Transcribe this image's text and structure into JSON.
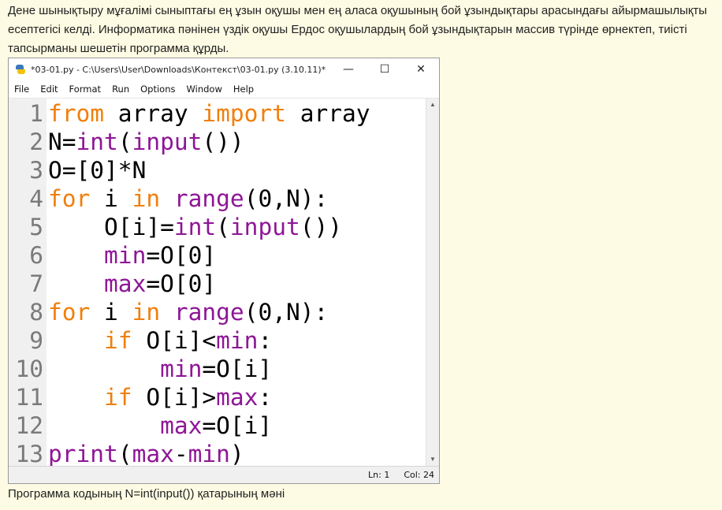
{
  "intro_text": "Дене шынықтыру мұғалімі сыныптағы ең ұзын оқушы мен ең аласа оқушының бой ұзындықтары арасындағы айырмашылықты есептегісі келді. Информатика пәнінен үздік оқушы Ердос оқушылардың бой ұзындықтарын массив түрінде өрнектеп, тиісті тапсырманы шешетін программа құрды.",
  "window": {
    "title": "*03-01.py - C:\\Users\\User\\Downloads\\Контекст\\03-01.py (3.10.11)*",
    "app_icon": "python-idle-icon",
    "controls": {
      "minimize": "—",
      "maximize": "☐",
      "close": "✕"
    }
  },
  "menu": [
    {
      "label": "File"
    },
    {
      "label": "Edit"
    },
    {
      "label": "Format"
    },
    {
      "label": "Run"
    },
    {
      "label": "Options"
    },
    {
      "label": "Window"
    },
    {
      "label": "Help"
    }
  ],
  "line_numbers": [
    "1",
    "2",
    "3",
    "4",
    "5",
    "6",
    "7",
    "8",
    "9",
    "10",
    "11",
    "12",
    "13"
  ],
  "code_lines": [
    [
      {
        "t": "from",
        "c": "kw"
      },
      {
        "t": " array ",
        "c": ""
      },
      {
        "t": "import",
        "c": "kw"
      },
      {
        "t": " array",
        "c": ""
      }
    ],
    [
      {
        "t": "N=",
        "c": ""
      },
      {
        "t": "int",
        "c": "bi"
      },
      {
        "t": "(",
        "c": ""
      },
      {
        "t": "input",
        "c": "bi"
      },
      {
        "t": "())",
        "c": ""
      }
    ],
    [
      {
        "t": "O=[0]*N",
        "c": ""
      }
    ],
    [
      {
        "t": "for",
        "c": "kw"
      },
      {
        "t": " i ",
        "c": ""
      },
      {
        "t": "in",
        "c": "kw"
      },
      {
        "t": " ",
        "c": ""
      },
      {
        "t": "range",
        "c": "bi"
      },
      {
        "t": "(0,N):",
        "c": ""
      }
    ],
    [
      {
        "t": "    O[i]=",
        "c": ""
      },
      {
        "t": "int",
        "c": "bi"
      },
      {
        "t": "(",
        "c": ""
      },
      {
        "t": "input",
        "c": "bi"
      },
      {
        "t": "())",
        "c": ""
      }
    ],
    [
      {
        "t": "    ",
        "c": ""
      },
      {
        "t": "min",
        "c": "bi"
      },
      {
        "t": "=O[0]",
        "c": ""
      }
    ],
    [
      {
        "t": "    ",
        "c": ""
      },
      {
        "t": "max",
        "c": "bi"
      },
      {
        "t": "=O[0]",
        "c": ""
      }
    ],
    [
      {
        "t": "for",
        "c": "kw"
      },
      {
        "t": " i ",
        "c": ""
      },
      {
        "t": "in",
        "c": "kw"
      },
      {
        "t": " ",
        "c": ""
      },
      {
        "t": "range",
        "c": "bi"
      },
      {
        "t": "(0,N):",
        "c": ""
      }
    ],
    [
      {
        "t": "    ",
        "c": ""
      },
      {
        "t": "if",
        "c": "kw"
      },
      {
        "t": " O[i]<",
        "c": ""
      },
      {
        "t": "min",
        "c": "bi"
      },
      {
        "t": ":",
        "c": ""
      }
    ],
    [
      {
        "t": "        ",
        "c": ""
      },
      {
        "t": "min",
        "c": "bi"
      },
      {
        "t": "=O[i]",
        "c": ""
      }
    ],
    [
      {
        "t": "    ",
        "c": ""
      },
      {
        "t": "if",
        "c": "kw"
      },
      {
        "t": " O[i]>",
        "c": ""
      },
      {
        "t": "max",
        "c": "bi"
      },
      {
        "t": ":",
        "c": ""
      }
    ],
    [
      {
        "t": "        ",
        "c": ""
      },
      {
        "t": "max",
        "c": "bi"
      },
      {
        "t": "=O[i]",
        "c": ""
      }
    ],
    [
      {
        "t": "print",
        "c": "bi"
      },
      {
        "t": "(",
        "c": ""
      },
      {
        "t": "max",
        "c": "bi"
      },
      {
        "t": "-",
        "c": ""
      },
      {
        "t": "min",
        "c": "bi"
      },
      {
        "t": ")",
        "c": ""
      }
    ]
  ],
  "status": {
    "line": "Ln: 1",
    "col": "Col: 24"
  },
  "question_text": "Программа кодының N=int(input())  қатарының мәні",
  "colors": {
    "keyword": "#f07f0d",
    "builtin": "#8e1696",
    "page_bg": "#fdfbe3"
  }
}
